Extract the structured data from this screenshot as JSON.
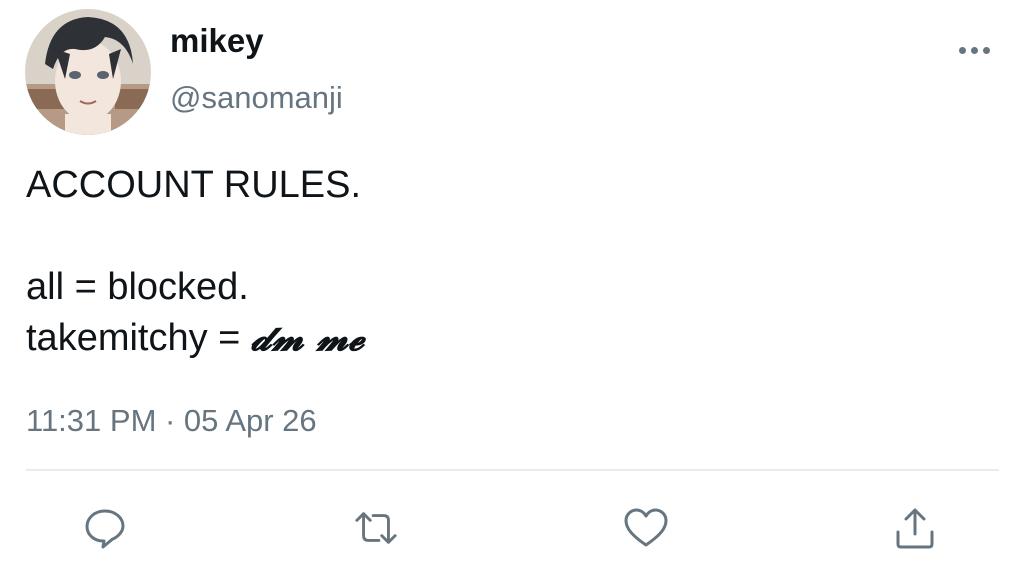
{
  "author": {
    "display_name": "mikey",
    "handle": "@sanomanji",
    "avatar_icon": "profile-avatar"
  },
  "tweet": {
    "lines": [
      "ACCOUNT RULES.",
      "",
      "all = blocked.",
      "takemitchy = "
    ],
    "styled_suffix": "𝓭𝓶 𝓶𝓮",
    "timestamp": "11:31 PM · 05 Apr 26"
  },
  "actions": {
    "reply_icon": "speech-bubble-icon",
    "retweet_icon": "retweet-arrows-icon",
    "like_icon": "heart-icon",
    "share_icon": "share-upload-icon",
    "more_icon": "ellipsis-icon"
  },
  "colors": {
    "text": "#0f1419",
    "secondary": "#66757f",
    "divider": "#e6ecf0"
  }
}
